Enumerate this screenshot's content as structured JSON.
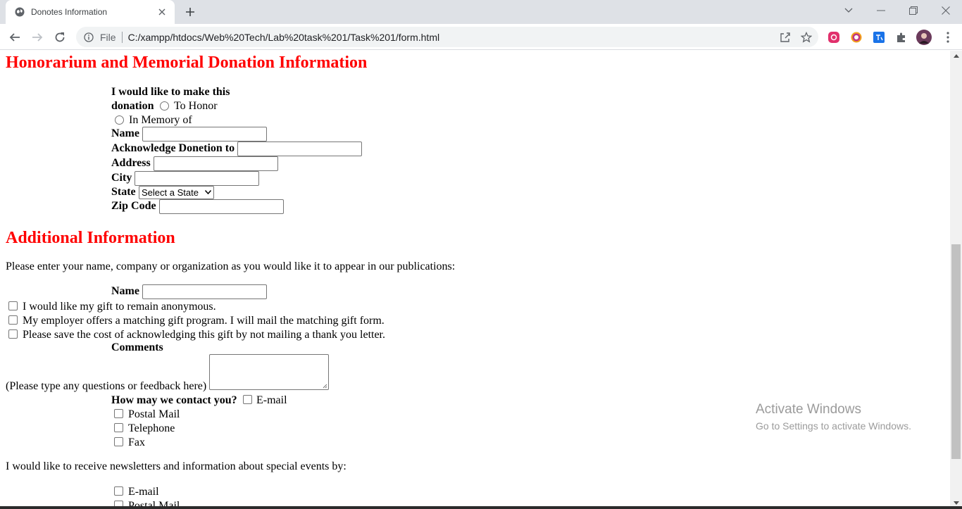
{
  "browser": {
    "tab_title": "Donotes Information",
    "omnibox_scheme": "File",
    "url": "C:/xampp/htdocs/Web%20Tech/Lab%20task%201/Task%201/form.html"
  },
  "page": {
    "heading_honorarium": "Honorarium and Memorial Donation Information",
    "donation_prompt_line1": "I would like to make this",
    "donation_prompt_line2": "donation",
    "option_to_honor": "To Honor",
    "option_in_memory": "In Memory of",
    "label_name": "Name",
    "label_acknowledge": "Acknowledge Donetion to",
    "label_address": "Address",
    "label_city": "City",
    "label_state": "State",
    "state_select_value": "Select a State",
    "label_zip": "Zip Code",
    "heading_additional": "Additional Information",
    "publication_prompt": "Please enter your name, company or organization as you would like it to appear in our publications:",
    "label_pub_name": "Name",
    "check_anonymous": "I would like my gift to remain anonymous.",
    "check_employer": "My employer offers a matching gift program. I will mail the matching gift form.",
    "check_save_cost": "Please save the cost of acknowledging this gift by not mailing a thank you letter.",
    "label_comments": "Comments",
    "comments_hint": "(Please type any questions or feedback here)",
    "contact_prompt": "How may we contact you?",
    "contact_email": "E-mail",
    "contact_postal": "Postal Mail",
    "contact_telephone": "Telephone",
    "contact_fax": "Fax",
    "newsletter_prompt": "I would like to receive newsletters and information about special events by:",
    "news_email": "E-mail",
    "news_postal": "Postal Mail"
  },
  "watermark": {
    "line1": "Activate Windows",
    "line2": "Go to Settings to activate Windows."
  }
}
